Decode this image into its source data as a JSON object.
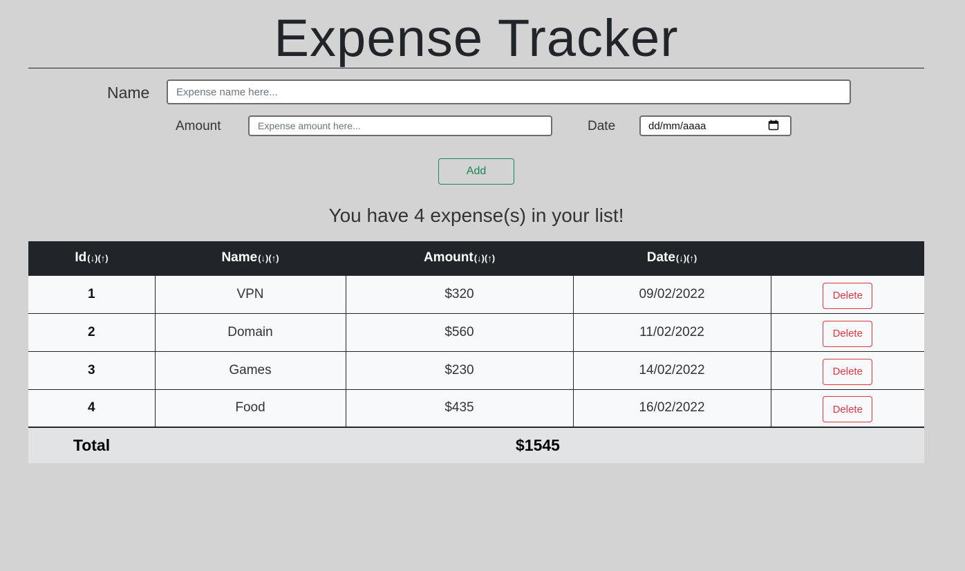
{
  "title": "Expense Tracker",
  "form": {
    "name_label": "Name",
    "name_placeholder": "Expense name here...",
    "amount_label": "Amount",
    "amount_placeholder": "Expense amount here...",
    "date_label": "Date",
    "date_value": "dd/mm/aaaa",
    "add_label": "Add"
  },
  "summary": "You have 4 expense(s) in your list!",
  "table": {
    "headers": [
      {
        "label": "Id",
        "arrows": "(↓)(↑)"
      },
      {
        "label": "Name",
        "arrows": "(↓)(↑)"
      },
      {
        "label": "Amount",
        "arrows": "(↓)(↑)"
      },
      {
        "label": "Date",
        "arrows": "(↓)(↑)"
      }
    ],
    "rows": [
      {
        "id": "1",
        "name": "VPN",
        "amount": "$320",
        "date": "09/02/2022",
        "action": "Delete"
      },
      {
        "id": "2",
        "name": "Domain",
        "amount": "$560",
        "date": "11/02/2022",
        "action": "Delete"
      },
      {
        "id": "3",
        "name": "Games",
        "amount": "$230",
        "date": "14/02/2022",
        "action": "Delete"
      },
      {
        "id": "4",
        "name": "Food",
        "amount": "$435",
        "date": "16/02/2022",
        "action": "Delete"
      }
    ],
    "total_label": "Total",
    "total_value": "$1545"
  },
  "colors": {
    "add": "#198754",
    "delete": "#dc3545",
    "header_bg": "#212529",
    "page_bg": "#d3d3d3"
  },
  "icons": {
    "date": "calendar-icon"
  }
}
